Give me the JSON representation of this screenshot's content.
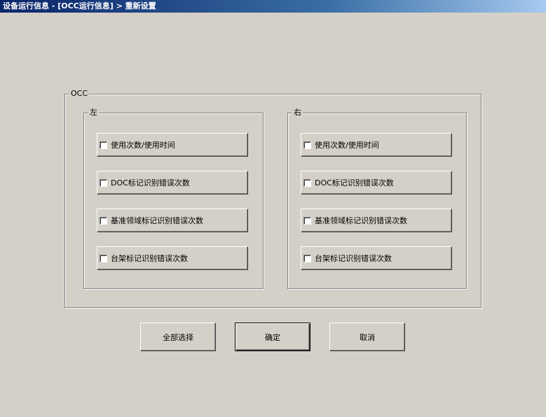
{
  "window": {
    "title": "设备运行信息 - [OCC运行信息] > 重新设置"
  },
  "group_occ": {
    "label": "OCC"
  },
  "group_left": {
    "label": "左",
    "items": [
      {
        "label": "使用次数/使用时间",
        "checked": false
      },
      {
        "label": "DOC标记识别错误次数",
        "checked": false
      },
      {
        "label": "基准领域标记识别错误次数",
        "checked": false
      },
      {
        "label": "台架标记识别错误次数",
        "checked": false
      }
    ]
  },
  "group_right": {
    "label": "右",
    "items": [
      {
        "label": "使用次数/使用时间",
        "checked": false
      },
      {
        "label": "DOC标记识别错误次数",
        "checked": false
      },
      {
        "label": "基准领域标记识别错误次数",
        "checked": false
      },
      {
        "label": "台架标记识别错误次数",
        "checked": false
      }
    ]
  },
  "buttons": {
    "select_all": "全部选择",
    "ok": "确定",
    "cancel": "取消"
  },
  "colors": {
    "face": "#d4d0c8",
    "title_start": "#0a246a",
    "title_end": "#a6caf0"
  }
}
